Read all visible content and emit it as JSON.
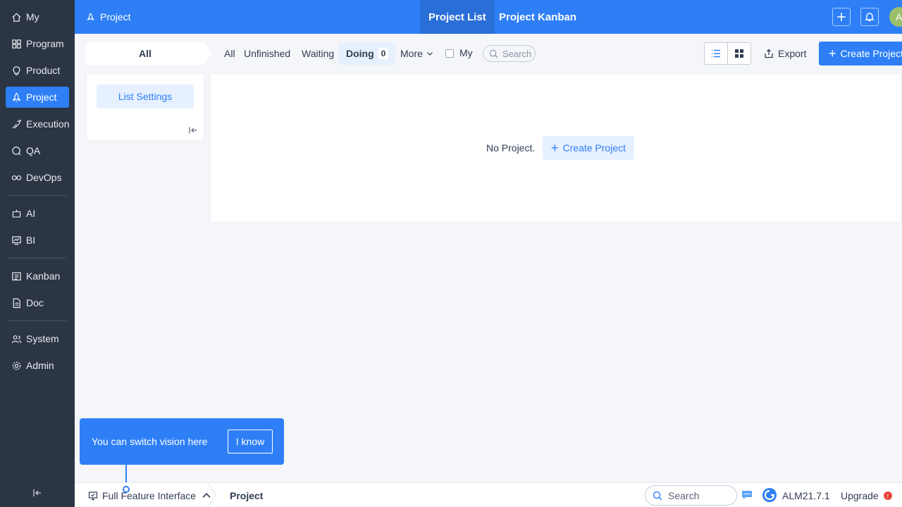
{
  "sidebar": {
    "items": [
      {
        "label": "My",
        "icon": "home-icon"
      },
      {
        "label": "Program",
        "icon": "grid-icon"
      },
      {
        "label": "Product",
        "icon": "bulb-icon"
      },
      {
        "label": "Project",
        "icon": "rocket-icon",
        "active": true
      },
      {
        "label": "Execution",
        "icon": "sprint-icon"
      },
      {
        "label": "QA",
        "icon": "qa-icon"
      },
      {
        "label": "DevOps",
        "icon": "infinity-icon"
      },
      {
        "label": "AI",
        "icon": "robot-icon"
      },
      {
        "label": "BI",
        "icon": "chart-icon"
      },
      {
        "label": "Kanban",
        "icon": "kanban-icon"
      },
      {
        "label": "Doc",
        "icon": "doc-icon"
      },
      {
        "label": "System",
        "icon": "users-icon"
      },
      {
        "label": "Admin",
        "icon": "gear-icon"
      }
    ]
  },
  "header": {
    "module": "Project",
    "tabs": [
      {
        "label": "Project List",
        "active": true
      },
      {
        "label": "Project Kanban",
        "active": false
      }
    ],
    "avatar_initial": "A"
  },
  "toolbar": {
    "crumb": "All",
    "filters": [
      "All",
      "Unfinished",
      "Waiting",
      "Doing",
      "More"
    ],
    "doing_count": "0",
    "my_label": "My",
    "search_placeholder": "Search",
    "export_label": "Export",
    "create_label": "Create Project"
  },
  "side_panel": {
    "list_settings": "List Settings"
  },
  "main": {
    "empty_text": "No Project.",
    "empty_create_label": "Create Project"
  },
  "tip": {
    "text": "You can switch vision here",
    "button": "I know"
  },
  "footer": {
    "interface_label": "Full Feature Interface",
    "crumb": "Project",
    "search_placeholder": "Search",
    "version": "ALM21.7.1",
    "upgrade": "Upgrade"
  },
  "colors": {
    "primary": "#2e7ff6",
    "sidebar_bg": "#2b3544",
    "page_bg": "#f5f6fa"
  }
}
